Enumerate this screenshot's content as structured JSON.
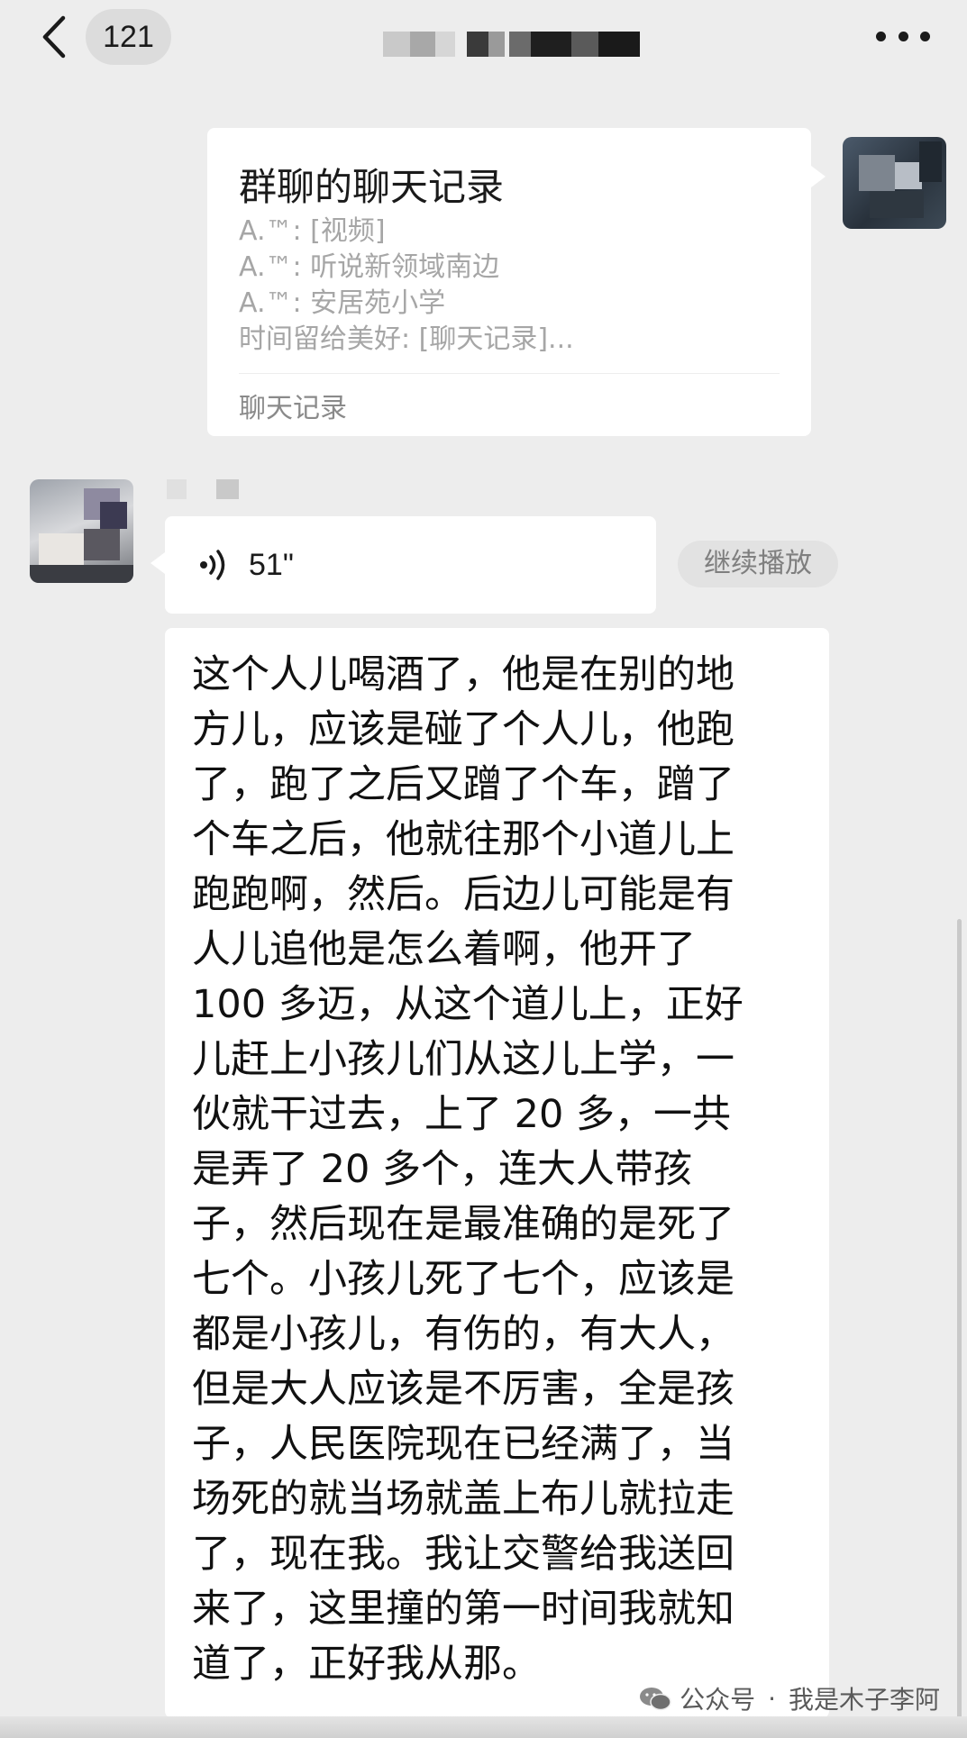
{
  "header": {
    "unread_count": "121",
    "title_hint": "blurred-chat-name"
  },
  "record_card": {
    "title": "群聊的聊天记录",
    "lines": [
      "A.™: [视频]",
      "A.™: 听说新领域南边",
      "A.™: 安居苑小学",
      "时间留给美好: [聊天记录]..."
    ],
    "footer": "聊天记录"
  },
  "voice_message": {
    "duration": "51\"",
    "continue_label": "继续播放"
  },
  "transcript": {
    "lines": [
      "这个人儿喝酒了，他是在别的地",
      "方儿，应该是碰了个人儿，他跑",
      "了，跑了之后又蹭了个车，蹭了",
      "个车之后，他就往那个小道儿上",
      "跑跑啊，然后。后边儿可能是有",
      "人儿追他是怎么着啊，他开了",
      "100 多迈，从这个道儿上，正好",
      "儿赶上小孩儿们从这儿上学，一",
      "伙就干过去，上了 20 多，一共",
      "是弄了 20 多个，连大人带孩",
      "子，然后现在是最准确的是死了",
      "七个。小孩儿死了七个，应该是",
      "都是小孩儿，有伤的，有大人，",
      "但是大人应该是不厉害，全是孩",
      "子，人民医院现在已经满了，当",
      "场死的就当场就盖上布儿就拉走",
      "了，现在我。我让交警给我送回",
      "来了，这里撞的第一时间我就知",
      "道了，正好我从那。"
    ]
  },
  "watermark": {
    "prefix": "公众号",
    "separator": "·",
    "name": "我是木子李阿"
  },
  "colors": {
    "background": "#ededed",
    "bubble": "#ffffff",
    "text": "#111111",
    "muted": "#a6a6a6"
  },
  "icons": [
    "back-arrow-icon",
    "more-dots-icon",
    "voice-wave-icon",
    "wechat-official-icon"
  ]
}
